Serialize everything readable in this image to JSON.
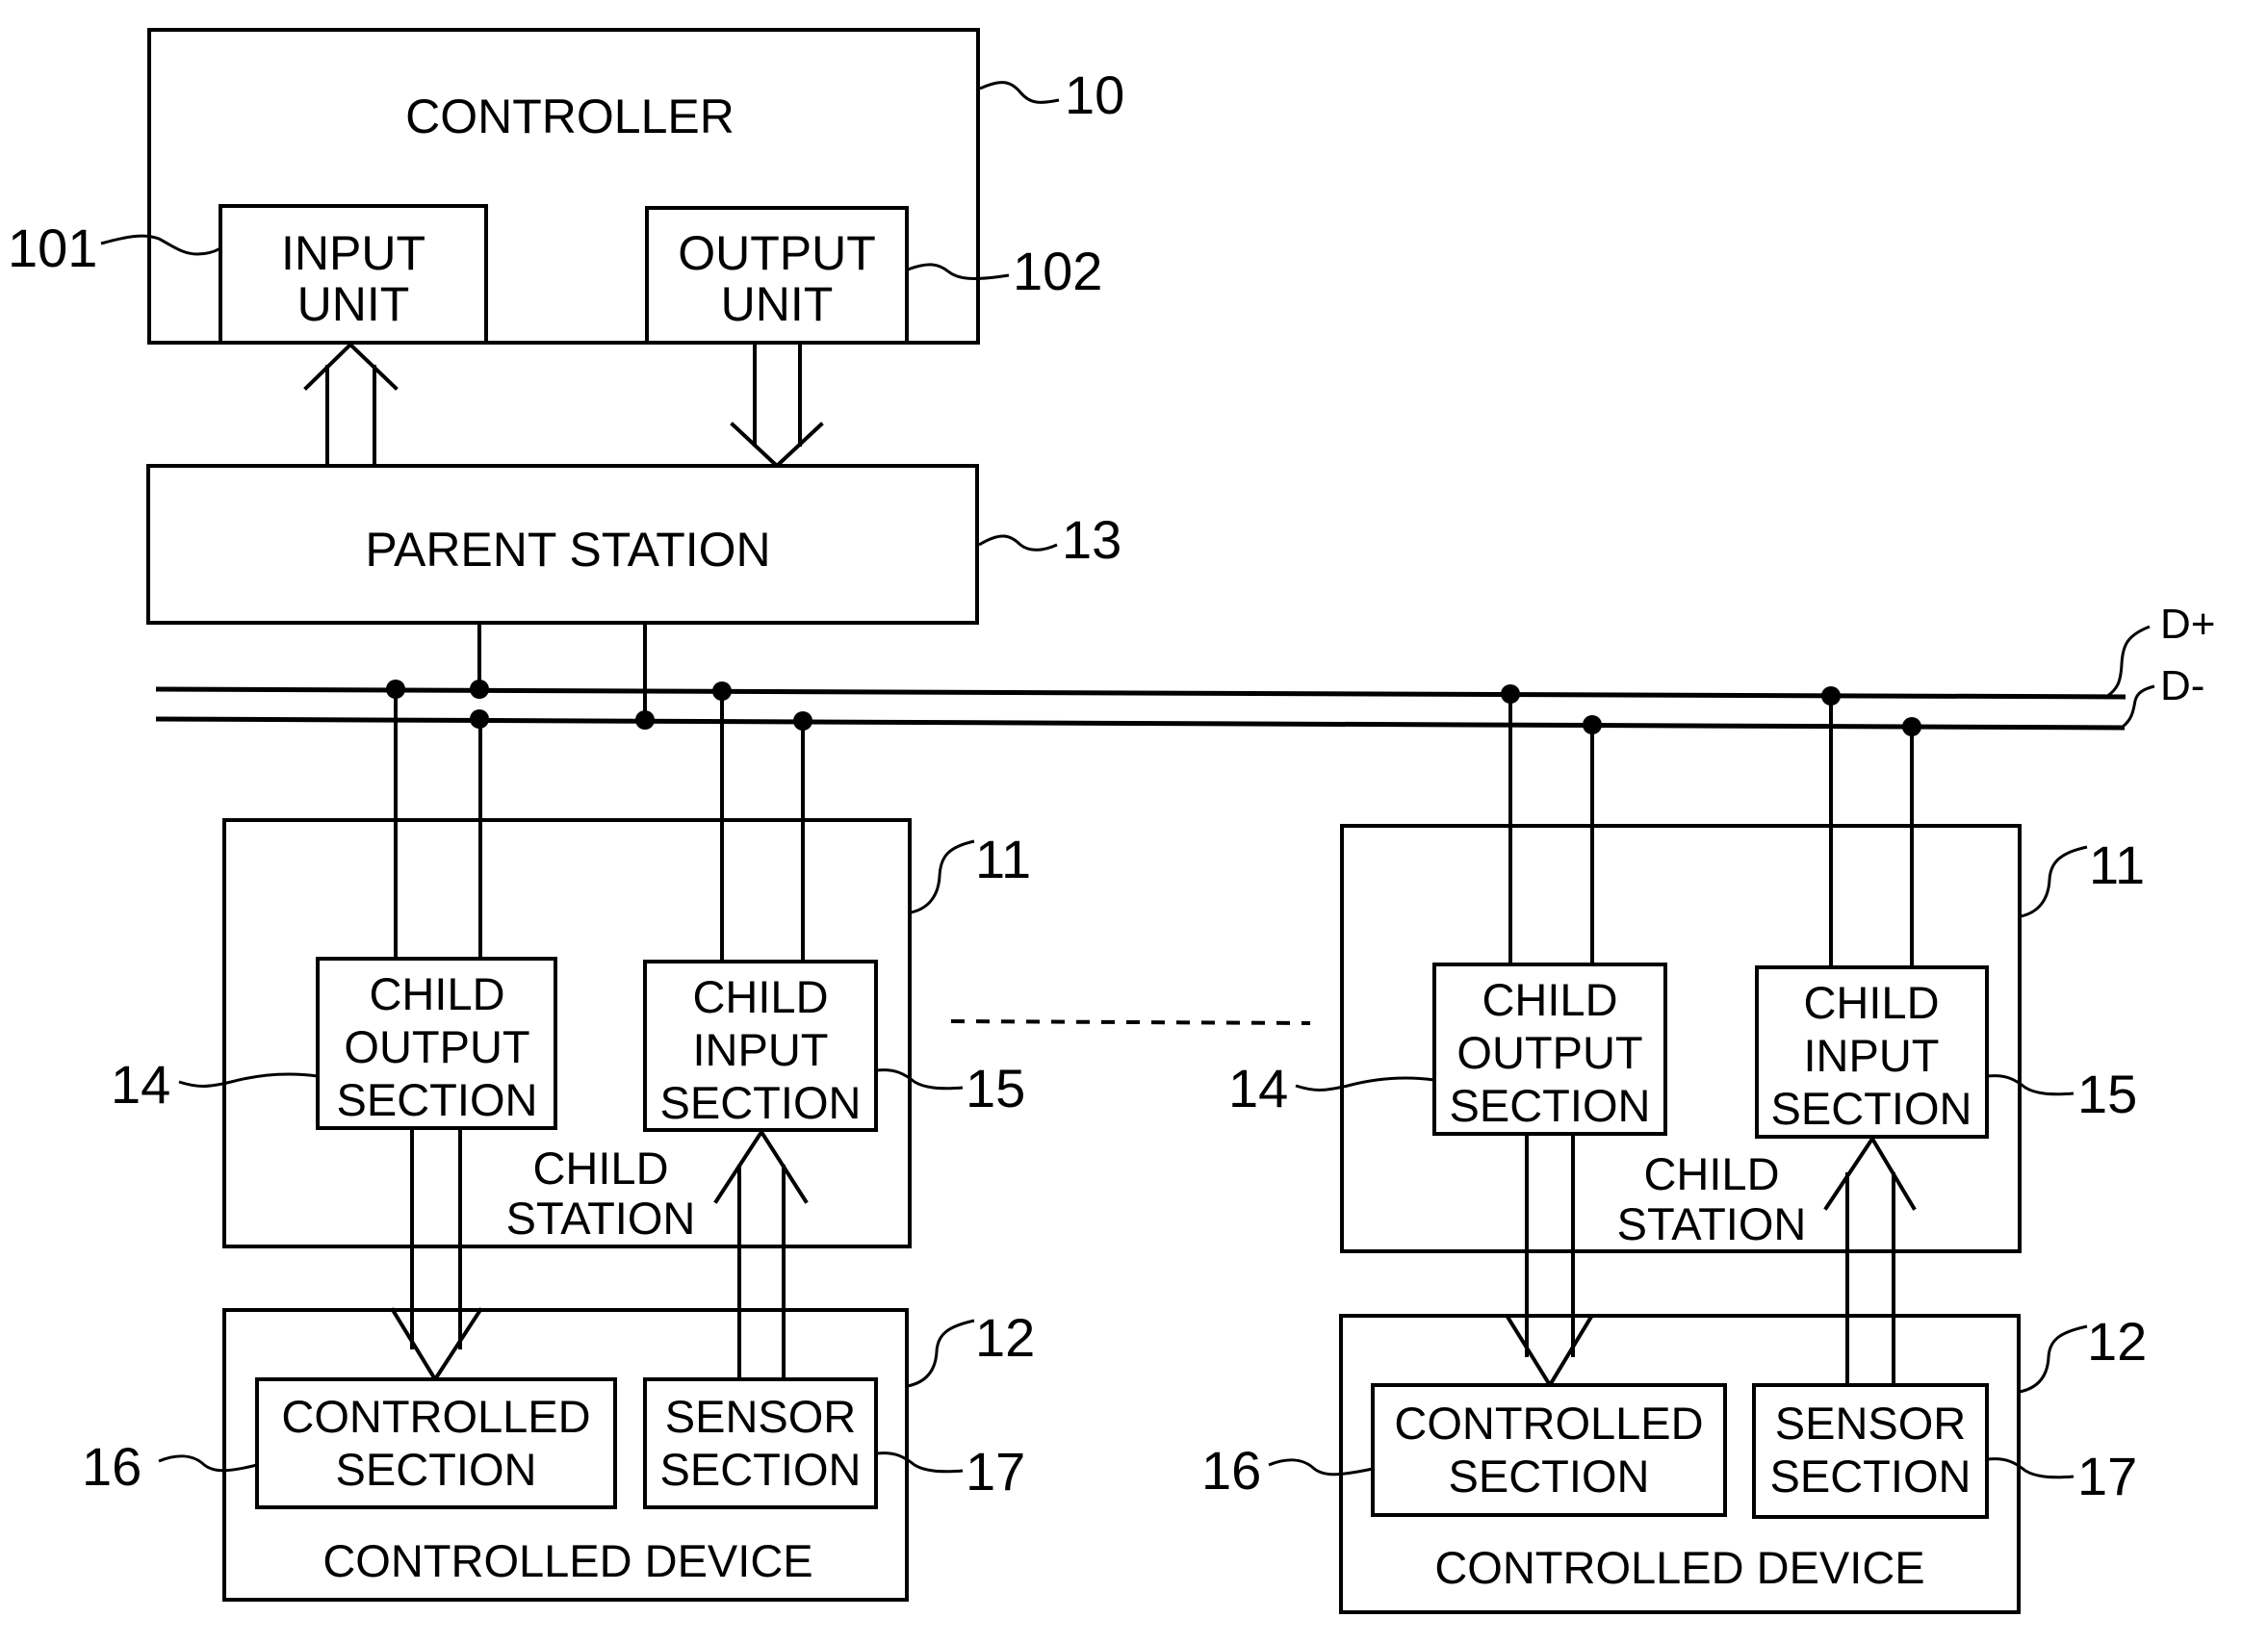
{
  "figure": {
    "controller": {
      "label": "CONTROLLER",
      "ref": "10",
      "input_unit": {
        "lines": [
          "INPUT",
          "UNIT"
        ],
        "ref": "101"
      },
      "output_unit": {
        "lines": [
          "OUTPUT",
          "UNIT"
        ],
        "ref": "102"
      }
    },
    "parent_station": {
      "label": "PARENT STATION",
      "ref": "13"
    },
    "bus": {
      "lines": [
        {
          "label": "D+"
        },
        {
          "label": "D-"
        }
      ]
    },
    "stations": [
      {
        "child_station": {
          "lines": [
            "CHILD",
            "STATION"
          ],
          "ref": "11",
          "output_section": {
            "lines": [
              "CHILD",
              "OUTPUT",
              "SECTION"
            ],
            "ref": "14"
          },
          "input_section": {
            "lines": [
              "CHILD",
              "INPUT",
              "SECTION"
            ],
            "ref": "15"
          }
        },
        "controlled_device": {
          "label": "CONTROLLED DEVICE",
          "ref": "12",
          "controlled_section": {
            "lines": [
              "CONTROLLED",
              "SECTION"
            ],
            "ref": "16"
          },
          "sensor_section": {
            "lines": [
              "SENSOR",
              "SECTION"
            ],
            "ref": "17"
          }
        }
      },
      {
        "child_station": {
          "lines": [
            "CHILD",
            "STATION"
          ],
          "ref": "11",
          "output_section": {
            "lines": [
              "CHILD",
              "OUTPUT",
              "SECTION"
            ],
            "ref": "14"
          },
          "input_section": {
            "lines": [
              "CHILD",
              "INPUT",
              "SECTION"
            ],
            "ref": "15"
          }
        },
        "controlled_device": {
          "label": "CONTROLLED DEVICE",
          "ref": "12",
          "controlled_section": {
            "lines": [
              "CONTROLLED",
              "SECTION"
            ],
            "ref": "16"
          },
          "sensor_section": {
            "lines": [
              "SENSOR",
              "SECTION"
            ],
            "ref": "17"
          }
        }
      }
    ]
  }
}
